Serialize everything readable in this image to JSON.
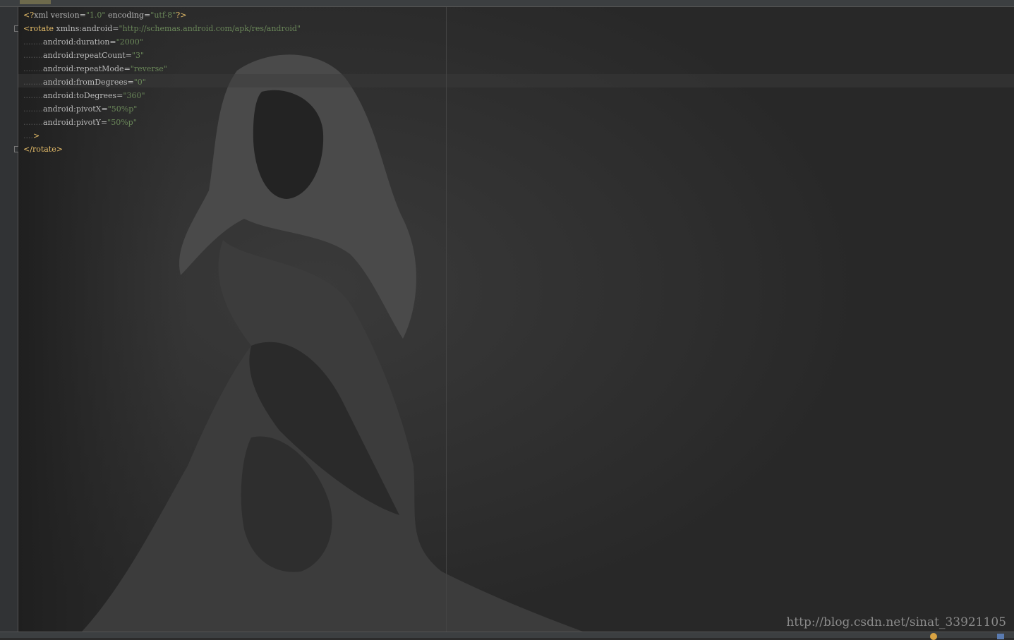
{
  "code": {
    "lines": [
      {
        "parts": [
          {
            "t": "<?",
            "c": "pi"
          },
          {
            "t": "xml version",
            "c": "attr"
          },
          {
            "t": "=",
            "c": "attr"
          },
          {
            "t": "\"1.0\"",
            "c": "val"
          },
          {
            "t": " encoding",
            "c": "attr"
          },
          {
            "t": "=",
            "c": "attr"
          },
          {
            "t": "\"utf-8\"",
            "c": "val"
          },
          {
            "t": "?>",
            "c": "pi"
          }
        ]
      },
      {
        "parts": [
          {
            "t": "<",
            "c": "tag"
          },
          {
            "t": "rotate",
            "c": "tag"
          },
          {
            "t": " xmlns",
            "c": "attr"
          },
          {
            "t": ":",
            "c": "attr"
          },
          {
            "t": "android",
            "c": "attr"
          },
          {
            "t": "=",
            "c": "attr"
          },
          {
            "t": "\"http://schemas.android.com/apk/res/android\"",
            "c": "val"
          }
        ]
      },
      {
        "parts": [
          {
            "t": "........",
            "c": "dots"
          },
          {
            "t": "android",
            "c": "attr"
          },
          {
            "t": ":",
            "c": "attr"
          },
          {
            "t": "duration",
            "c": "attr"
          },
          {
            "t": "=",
            "c": "attr"
          },
          {
            "t": "\"2000\"",
            "c": "val"
          }
        ]
      },
      {
        "parts": [
          {
            "t": "........",
            "c": "dots"
          },
          {
            "t": "android",
            "c": "attr"
          },
          {
            "t": ":",
            "c": "attr"
          },
          {
            "t": "repeatCount",
            "c": "attr"
          },
          {
            "t": "=",
            "c": "attr"
          },
          {
            "t": "\"3\"",
            "c": "val"
          }
        ]
      },
      {
        "parts": [
          {
            "t": "........",
            "c": "dots"
          },
          {
            "t": "android",
            "c": "attr"
          },
          {
            "t": ":",
            "c": "attr"
          },
          {
            "t": "repeatMode",
            "c": "attr"
          },
          {
            "t": "=",
            "c": "attr"
          },
          {
            "t": "\"reverse\"",
            "c": "val"
          }
        ]
      },
      {
        "parts": [
          {
            "t": "........",
            "c": "dots"
          },
          {
            "t": "android",
            "c": "attr"
          },
          {
            "t": ":",
            "c": "attr"
          },
          {
            "t": "fromDegrees",
            "c": "attr"
          },
          {
            "t": "=",
            "c": "attr"
          },
          {
            "t": "\"0\"",
            "c": "val"
          }
        ]
      },
      {
        "parts": [
          {
            "t": "........",
            "c": "dots"
          },
          {
            "t": "android",
            "c": "attr"
          },
          {
            "t": ":",
            "c": "attr"
          },
          {
            "t": "toDegrees",
            "c": "attr"
          },
          {
            "t": "=",
            "c": "attr"
          },
          {
            "t": "\"360\"",
            "c": "val"
          }
        ]
      },
      {
        "parts": [
          {
            "t": "........",
            "c": "dots"
          },
          {
            "t": "android",
            "c": "attr"
          },
          {
            "t": ":",
            "c": "attr"
          },
          {
            "t": "pivotX",
            "c": "attr"
          },
          {
            "t": "=",
            "c": "attr"
          },
          {
            "t": "\"50%p\"",
            "c": "val"
          }
        ]
      },
      {
        "parts": [
          {
            "t": "........",
            "c": "dots"
          },
          {
            "t": "android",
            "c": "attr"
          },
          {
            "t": ":",
            "c": "attr"
          },
          {
            "t": "pivotY",
            "c": "attr"
          },
          {
            "t": "=",
            "c": "attr"
          },
          {
            "t": "\"50%p\"",
            "c": "val"
          }
        ]
      },
      {
        "parts": [
          {
            "t": "....",
            "c": "dots"
          },
          {
            "t": ">",
            "c": "tag"
          }
        ]
      },
      {
        "parts": [
          {
            "t": "</",
            "c": "tag"
          },
          {
            "t": "rotate",
            "c": "tag"
          },
          {
            "t": ">",
            "c": "tag"
          }
        ]
      }
    ]
  },
  "watermark": "http://blog.csdn.net/sinat_33921105",
  "colors": {
    "editor_bg": "#282828",
    "tag": "#e8bf6a",
    "attribute": "#bababa",
    "value": "#6a8759",
    "dots": "#555555"
  }
}
